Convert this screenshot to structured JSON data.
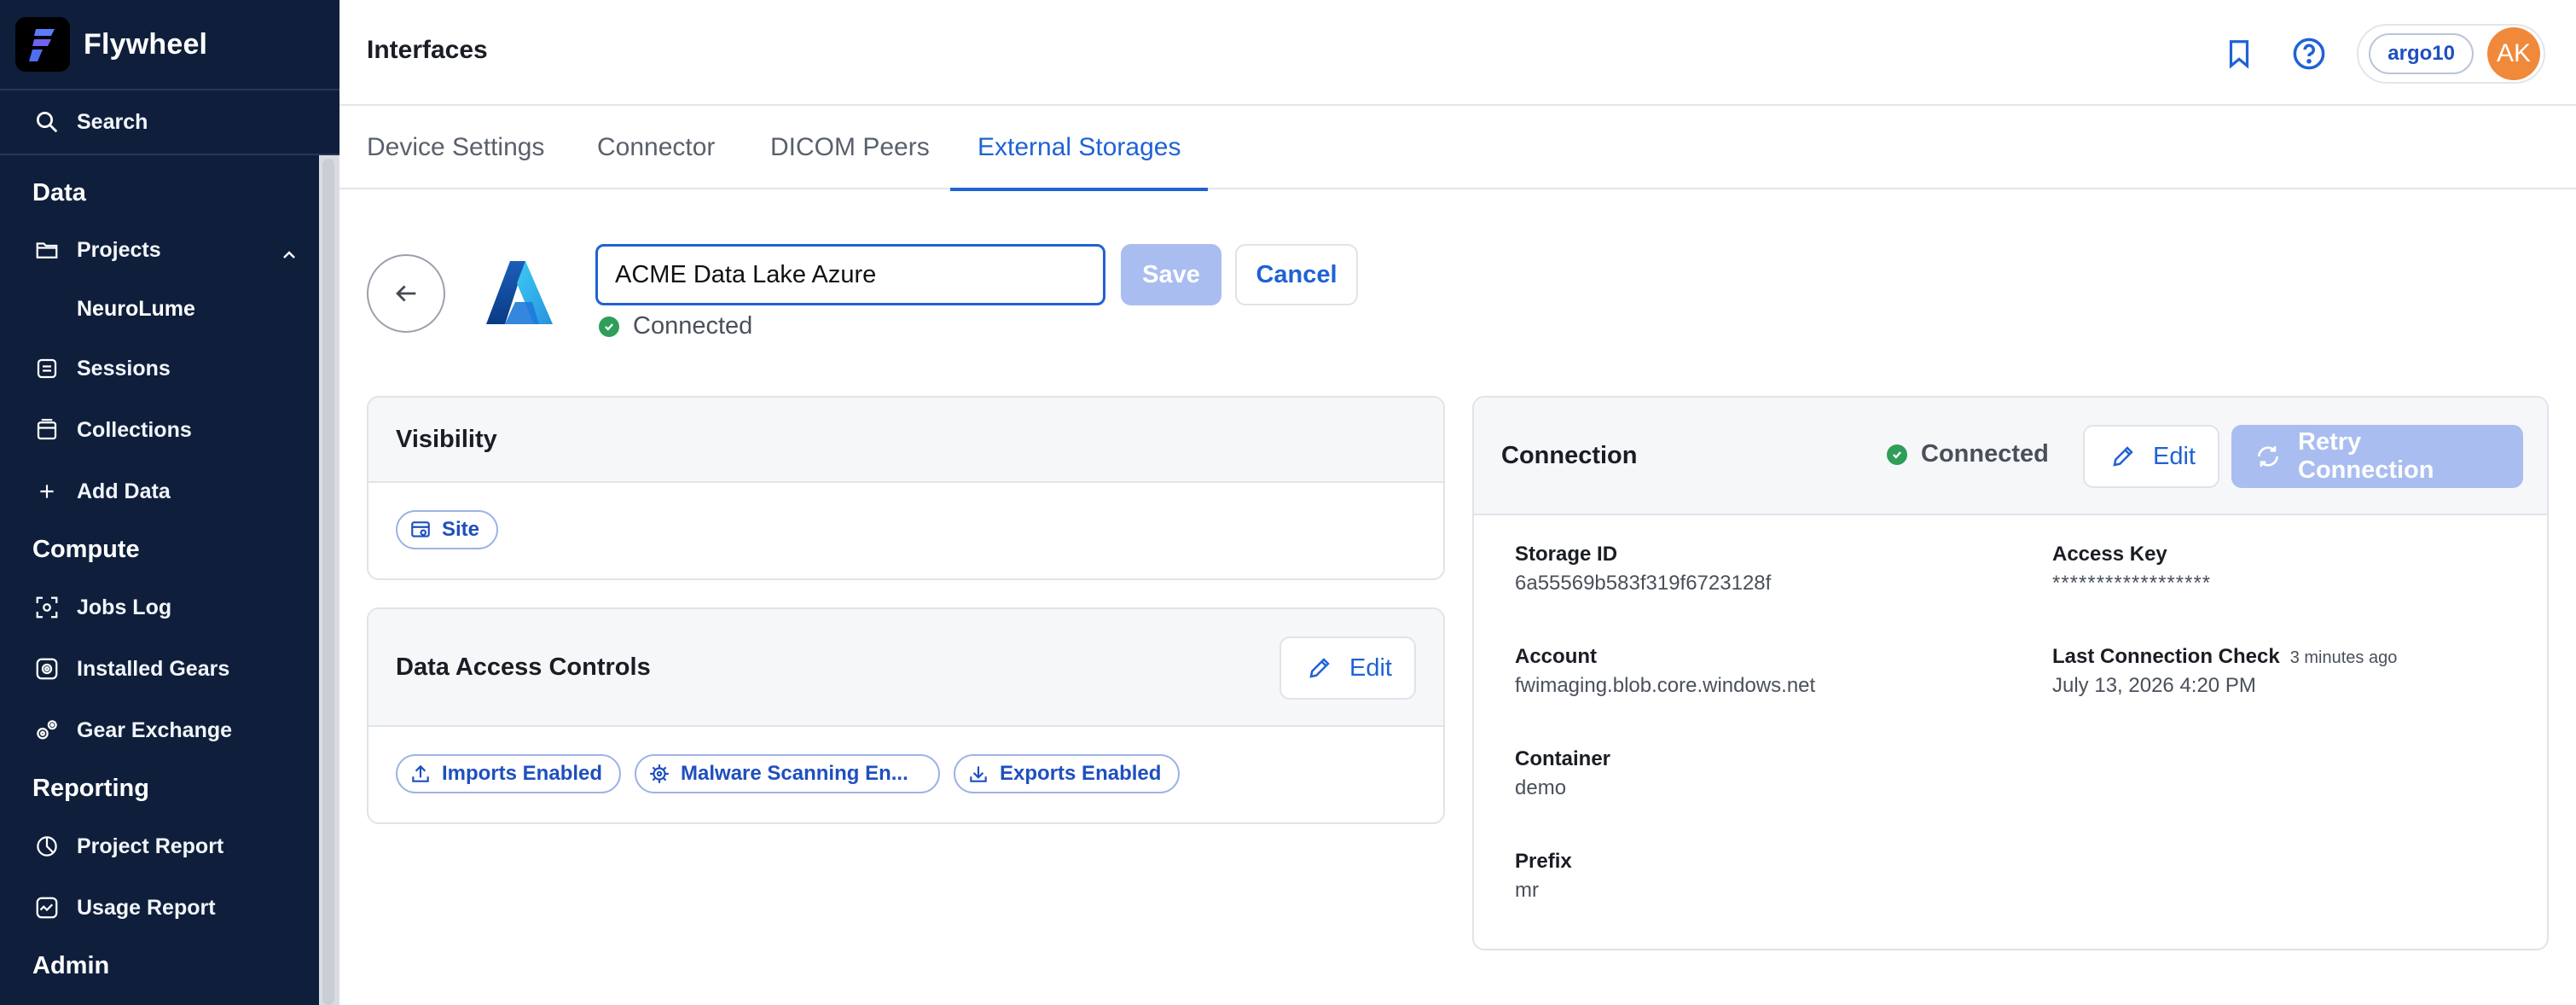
{
  "app": {
    "name": "Flywheel"
  },
  "sidebar": {
    "search_label": "Search",
    "sections": {
      "data": "Data",
      "compute": "Compute",
      "reporting": "Reporting",
      "admin": "Admin"
    },
    "items": {
      "projects": "Projects",
      "project_child": "NeuroLume",
      "sessions": "Sessions",
      "collections": "Collections",
      "add_data": "Add Data",
      "jobs_log": "Jobs Log",
      "installed_gears": "Installed Gears",
      "gear_exchange": "Gear Exchange",
      "project_report": "Project Report",
      "usage_report": "Usage Report"
    }
  },
  "header": {
    "title": "Interfaces",
    "user": {
      "name": "argo10",
      "initials": "AK"
    }
  },
  "tabs": [
    {
      "label": "Device Settings",
      "active": false
    },
    {
      "label": "Connector",
      "active": false
    },
    {
      "label": "DICOM Peers",
      "active": false
    },
    {
      "label": "External Storages",
      "active": true
    }
  ],
  "storage": {
    "name_value": "ACME Data Lake Azure",
    "save_label": "Save",
    "cancel_label": "Cancel",
    "status": "Connected"
  },
  "visibility": {
    "title": "Visibility",
    "chip": "Site"
  },
  "access_controls": {
    "title": "Data Access Controls",
    "edit_label": "Edit",
    "chips": [
      "Imports Enabled",
      "Malware Scanning En...",
      "Exports Enabled"
    ]
  },
  "connection": {
    "title": "Connection",
    "status": "Connected",
    "edit_label": "Edit",
    "retry_label": "Retry Connection",
    "fields": {
      "storage_id": {
        "label": "Storage ID",
        "value": "6a55569b583f319f6723128f"
      },
      "account": {
        "label": "Account",
        "value": "fwimaging.blob.core.windows.net"
      },
      "container": {
        "label": "Container",
        "value": "demo"
      },
      "prefix": {
        "label": "Prefix",
        "value": "mr"
      },
      "access_key": {
        "label": "Access Key",
        "value": "******************"
      },
      "last_check": {
        "label": "Last Connection Check",
        "note": "3 minutes ago",
        "value": "July 13, 2026 4:20 PM"
      }
    }
  },
  "colors": {
    "sidebar_bg": "#0f1f3b",
    "accent": "#1f62d4",
    "success": "#2f9e58",
    "disabled_button": "#a9bdf0",
    "avatar": "#f0893a"
  }
}
